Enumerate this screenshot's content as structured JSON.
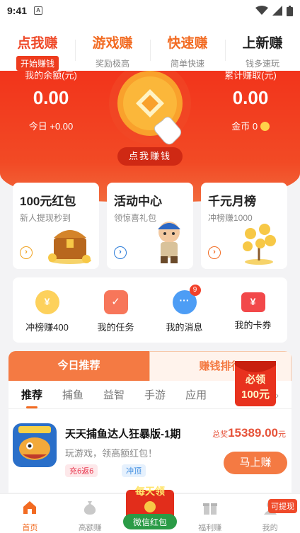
{
  "status_bar": {
    "time": "9:41"
  },
  "top_tabs": [
    {
      "title": "点我赚",
      "subtitle": "开始赚钱"
    },
    {
      "title": "游戏赚",
      "subtitle": "奖励极高"
    },
    {
      "title": "快速赚",
      "subtitle": "简单快速"
    },
    {
      "title": "上新赚",
      "subtitle": "钱多速玩"
    }
  ],
  "hero": {
    "balance_label": "我的余额(元)",
    "balance_value": "0.00",
    "today_text": "今日 +0.00",
    "total_label": "累计赚取(元)",
    "total_value": "0.00",
    "coins_text": "金币 0",
    "earn_button": "点我赚钱"
  },
  "feature_cards": [
    {
      "title": "100元红包",
      "subtitle": "新人提现秒到",
      "accent": "#f0a21e"
    },
    {
      "title": "活动中心",
      "subtitle": "领惊喜礼包",
      "accent": "#2a7bd8"
    },
    {
      "title": "千元月榜",
      "subtitle": "冲榜赚1000",
      "accent": "#f26b22"
    }
  ],
  "icon_row": [
    {
      "label": "冲榜赚400",
      "icon": "trophy-coin-icon"
    },
    {
      "label": "我的任务",
      "icon": "calendar-check-icon"
    },
    {
      "label": "我的消息",
      "icon": "chat-bubble-icon",
      "badge": "9"
    },
    {
      "label": "我的卡券",
      "icon": "ticket-icon"
    }
  ],
  "list_panel": {
    "tabs": [
      "今日推荐",
      "赚钱排行"
    ],
    "categories": [
      "推荐",
      "捕鱼",
      "益智",
      "手游",
      "应用"
    ],
    "game": {
      "name": "天天捕鱼达人狂暴版-1期",
      "desc": "玩游戏，领高额红包！",
      "prize_label": "总奖",
      "prize_value": "15389.00",
      "prize_unit": "元",
      "tags": [
        "充6返6",
        "冲顶"
      ],
      "button": "马上赚"
    }
  },
  "float_packet": {
    "line1": "必领",
    "line2": "100元"
  },
  "center_packet": {
    "top": "每天领",
    "bottom": "微信红包"
  },
  "bottom_nav": [
    {
      "label": "首页",
      "icon": "home-icon"
    },
    {
      "label": "高额赚",
      "icon": "money-bag-icon"
    },
    {
      "label": "",
      "icon": ""
    },
    {
      "label": "福利赚",
      "icon": "gift-icon"
    },
    {
      "label": "我的",
      "icon": "user-icon"
    }
  ],
  "withdraw_tag": "可提现",
  "colors": {
    "brand_red": "#f2341b",
    "accent_orange": "#f47a43"
  }
}
